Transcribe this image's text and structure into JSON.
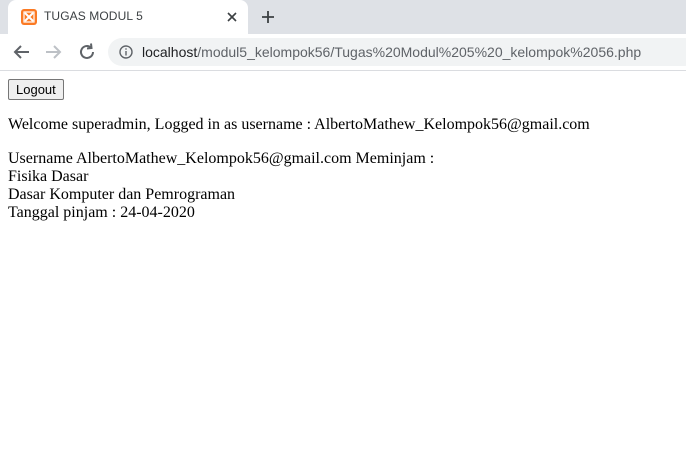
{
  "browser": {
    "tab_title": "TUGAS MODUL 5",
    "url_host": "localhost",
    "url_path": "/modul5_kelompok56/Tugas%20Modul%205%20_kelompok%2056.php"
  },
  "page": {
    "logout_label": "Logout",
    "welcome_text": "Welcome superadmin, Logged in as username : AlbertoMathew_Kelompok56@gmail.com",
    "loan_header": "Username AlbertoMathew_Kelompok56@gmail.com Meminjam :",
    "books": [
      "Fisika Dasar",
      "Dasar Komputer dan Pemrograman"
    ],
    "loan_date": "Tanggal pinjam : 24-04-2020"
  },
  "colors": {
    "tabstrip": "#dee1e6",
    "favicon": "#fb7a24",
    "omnibox": "#f1f3f4"
  },
  "icons": [
    "xampp-favicon-icon",
    "close-icon",
    "plus-icon",
    "back-arrow-icon",
    "forward-arrow-icon",
    "reload-icon",
    "info-icon"
  ]
}
